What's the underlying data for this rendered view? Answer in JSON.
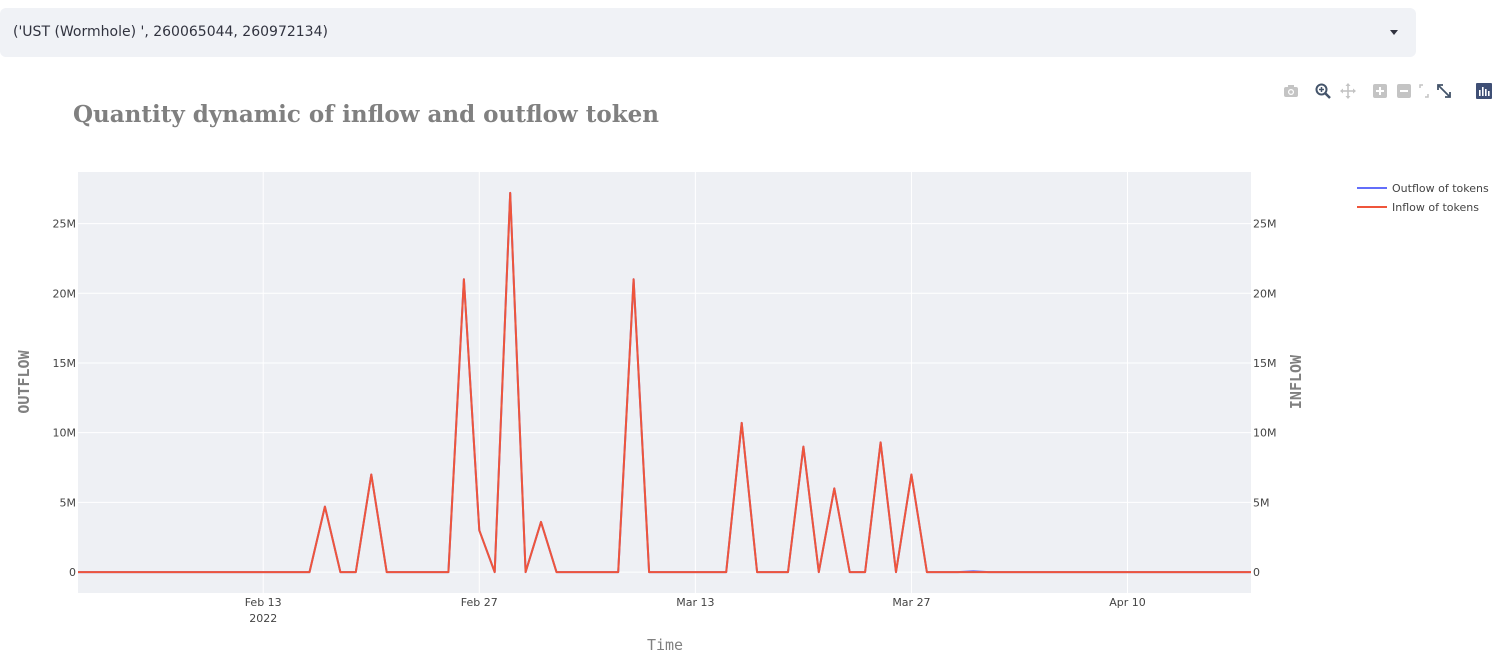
{
  "select": {
    "value": "('UST (Wormhole) ', 260065044, 260972134)"
  },
  "modebar": {
    "icons": [
      "camera-icon",
      "zoom-icon",
      "pan-icon",
      "zoom-in-icon",
      "zoom-out-icon",
      "autoscale-icon",
      "reset-axes-icon",
      "plotly-logo-icon"
    ]
  },
  "chart_data": {
    "type": "line",
    "title": "Quantity dynamic of inflow and outflow token",
    "xlabel": "Time",
    "ylabel_left": "OUTFLOW",
    "ylabel_right": "INFLOW",
    "x_start": "2022-02-01",
    "x_range": [
      "2022-02-01",
      "2022-04-18"
    ],
    "x_ticks": [
      "Feb 13",
      "Feb 27",
      "Mar 13",
      "Mar 27",
      "Apr 10"
    ],
    "x_tick_dates": [
      "2022-02-13",
      "2022-02-27",
      "2022-03-13",
      "2022-03-27",
      "2022-04-10"
    ],
    "x_tick_sublabel": "2022",
    "y_ticks": [
      "0",
      "5M",
      "10M",
      "15M",
      "20M",
      "25M"
    ],
    "y_tick_values": [
      0,
      5000000,
      10000000,
      15000000,
      20000000,
      25000000
    ],
    "ylim": [
      -1500000,
      28700000
    ],
    "grid": true,
    "legend_position": "top-right",
    "series": [
      {
        "name": "Outflow of tokens",
        "color": "#636efa",
        "points": [
          [
            "2022-02-01",
            0
          ],
          [
            "2022-02-16",
            0
          ],
          [
            "2022-02-17",
            4700000
          ],
          [
            "2022-02-18",
            0
          ],
          [
            "2022-02-19",
            0
          ],
          [
            "2022-02-20",
            7000000
          ],
          [
            "2022-02-21",
            0
          ],
          [
            "2022-02-25",
            0
          ],
          [
            "2022-02-26",
            21000000
          ],
          [
            "2022-02-27",
            3000000
          ],
          [
            "2022-02-28",
            0
          ],
          [
            "2022-03-01",
            27200000
          ],
          [
            "2022-03-02",
            0
          ],
          [
            "2022-03-03",
            3600000
          ],
          [
            "2022-03-04",
            0
          ],
          [
            "2022-03-08",
            0
          ],
          [
            "2022-03-09",
            21000000
          ],
          [
            "2022-03-10",
            0
          ],
          [
            "2022-03-15",
            0
          ],
          [
            "2022-03-16",
            10700000
          ],
          [
            "2022-03-17",
            0
          ],
          [
            "2022-03-19",
            0
          ],
          [
            "2022-03-20",
            9000000
          ],
          [
            "2022-03-21",
            0
          ],
          [
            "2022-03-22",
            6000000
          ],
          [
            "2022-03-23",
            0
          ],
          [
            "2022-03-24",
            0
          ],
          [
            "2022-03-25",
            9300000
          ],
          [
            "2022-03-26",
            0
          ],
          [
            "2022-03-27",
            7000000
          ],
          [
            "2022-03-28",
            0
          ],
          [
            "2022-03-30",
            0
          ],
          [
            "2022-03-31",
            60000
          ],
          [
            "2022-04-01",
            0
          ],
          [
            "2022-04-18",
            0
          ]
        ]
      },
      {
        "name": "Inflow of tokens",
        "color": "#ef553b",
        "points": [
          [
            "2022-02-01",
            0
          ],
          [
            "2022-02-16",
            0
          ],
          [
            "2022-02-17",
            4700000
          ],
          [
            "2022-02-18",
            0
          ],
          [
            "2022-02-19",
            0
          ],
          [
            "2022-02-20",
            7000000
          ],
          [
            "2022-02-21",
            0
          ],
          [
            "2022-02-25",
            0
          ],
          [
            "2022-02-26",
            21000000
          ],
          [
            "2022-02-27",
            3000000
          ],
          [
            "2022-02-28",
            0
          ],
          [
            "2022-03-01",
            27200000
          ],
          [
            "2022-03-02",
            0
          ],
          [
            "2022-03-03",
            3600000
          ],
          [
            "2022-03-04",
            0
          ],
          [
            "2022-03-08",
            0
          ],
          [
            "2022-03-09",
            21000000
          ],
          [
            "2022-03-10",
            0
          ],
          [
            "2022-03-15",
            0
          ],
          [
            "2022-03-16",
            10700000
          ],
          [
            "2022-03-17",
            0
          ],
          [
            "2022-03-19",
            0
          ],
          [
            "2022-03-20",
            9000000
          ],
          [
            "2022-03-21",
            0
          ],
          [
            "2022-03-22",
            6000000
          ],
          [
            "2022-03-23",
            0
          ],
          [
            "2022-03-24",
            0
          ],
          [
            "2022-03-25",
            9300000
          ],
          [
            "2022-03-26",
            0
          ],
          [
            "2022-03-27",
            7000000
          ],
          [
            "2022-03-28",
            0
          ],
          [
            "2022-04-18",
            0
          ]
        ]
      }
    ]
  }
}
